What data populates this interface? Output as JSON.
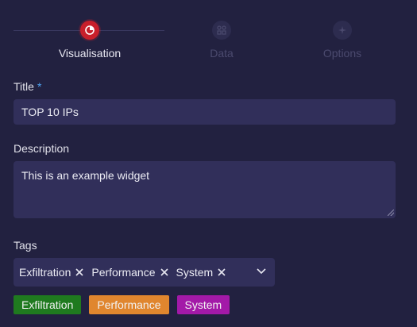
{
  "stepper": {
    "steps": [
      {
        "label": "Visualisation",
        "state": "active",
        "icon": "pie-chart-icon"
      },
      {
        "label": "Data",
        "state": "inactive",
        "icon": "grid-icon"
      },
      {
        "label": "Options",
        "state": "inactive",
        "icon": "sparkle-icon"
      }
    ]
  },
  "form": {
    "title_label": "Title",
    "required_mark": "*",
    "title_value": "TOP 10 IPs",
    "description_label": "Description",
    "description_value": "This is an example widget",
    "tags_label": "Tags",
    "selected_tags": [
      "Exfiltration",
      "Performance",
      "System"
    ],
    "tag_badges": [
      {
        "label": "Exfiltration",
        "color": "#1f7a1f"
      },
      {
        "label": "Performance",
        "color": "#e0862e"
      },
      {
        "label": "System",
        "color": "#a319a8"
      }
    ]
  },
  "colors": {
    "background": "#222140",
    "input": "#312f5a",
    "active_step": "#c81f2b",
    "required": "#4ea3f0"
  }
}
